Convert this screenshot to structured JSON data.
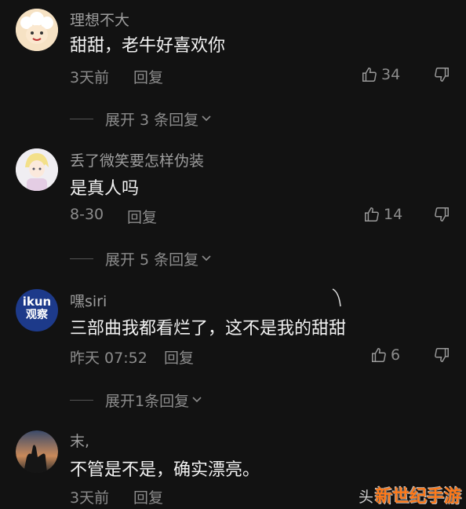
{
  "comments": [
    {
      "username": "理想不大",
      "content": "甜甜，老牛好喜欢你",
      "time": "3天前",
      "reply_label": "回复",
      "likes": "34",
      "expand_label": "展开 3 条回复",
      "avatar_icon": "sheep-avatar"
    },
    {
      "username": "丢了微笑要怎样伪装",
      "content": "是真人吗",
      "time": "8-30",
      "reply_label": "回复",
      "likes": "14",
      "expand_label": "展开 5 条回复",
      "avatar_icon": "anime-boy-avatar"
    },
    {
      "username": "嘿siri",
      "content": "三部曲我都看烂了，这不是我的甜甜",
      "time": "昨天 07:52",
      "reply_label": "回复",
      "likes": "6",
      "expand_label": "展开1条回复",
      "avatar_icon": "ikun-logo-avatar",
      "avatar_text_top": "ikun",
      "avatar_text_bottom": "观察"
    },
    {
      "username": "末,",
      "content": "不管是不是，确实漂亮。",
      "time": "3天前",
      "reply_label": "回复",
      "avatar_icon": "sunset-silhouette-avatar"
    }
  ],
  "watermark": {
    "prefix": "头",
    "text": "新世纪手游"
  },
  "colors": {
    "background": "#121212",
    "text_primary": "#f2f2f2",
    "text_secondary": "#8c8c8c",
    "watermark": "#ff7a1a"
  }
}
